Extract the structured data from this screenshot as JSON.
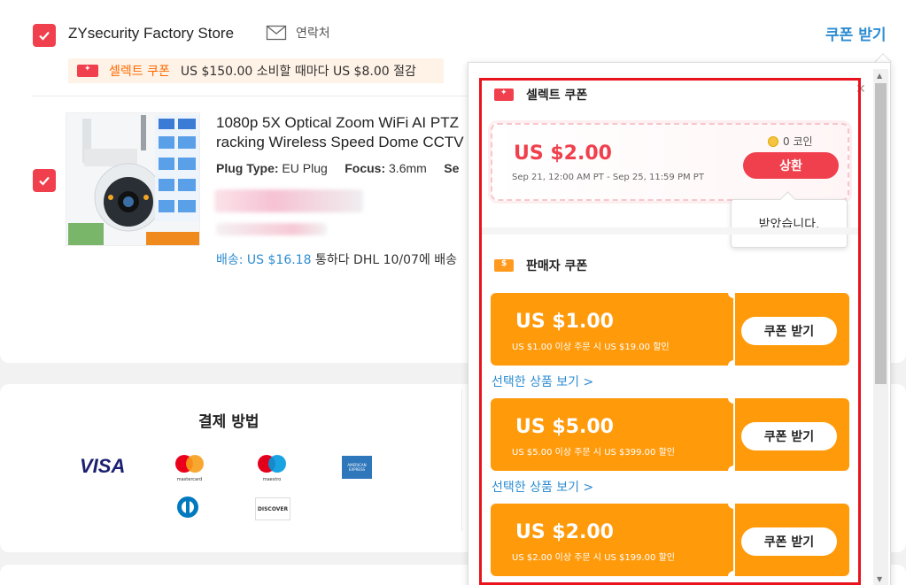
{
  "store": {
    "name": "ZYsecurity Factory Store",
    "contact_label": "연락처",
    "coupon_link": "쿠폰 받기"
  },
  "select_coupon_bar": {
    "label": "셀렉트 쿠폰",
    "description": "US $150.00 소비할 때마다 US $8.00 절감"
  },
  "product": {
    "title_line1": "1080p 5X Optical Zoom WiFi AI PTZ",
    "title_line2": "racking Wireless Speed Dome CCTV",
    "plug_label": "Plug Type:",
    "plug_value": "EU Plug",
    "focus_label": "Focus:",
    "focus_value": "3.6mm",
    "extra_label": "Se",
    "shipping_label": "배송: US $16.18",
    "shipping_rest": "통하다 DHL 10/07에 배송"
  },
  "payment": {
    "title": "결제 방법",
    "logos": [
      "VISA",
      "mastercard",
      "maestro",
      "AMERICAN EXPRESS",
      "Diners",
      "DISCOVER"
    ]
  },
  "popup": {
    "select_section_title": "셀렉트 쿠폰",
    "select_coupon": {
      "amount": "US $2.00",
      "period": "Sep 21, 12:00 AM PT - Sep 25, 11:59 PM PT",
      "coins": "0 코인",
      "redeem_label": "상환"
    },
    "tooltip": "받았습니다.",
    "seller_section_title": "판매자 쿠폰",
    "seller_coupons": [
      {
        "amount": "US $1.00",
        "desc": "US $1.00 이상 주문 시 US $19.00 할인",
        "button": "쿠폰 받기"
      },
      {
        "amount": "US $5.00",
        "desc": "US $5.00 이상 주문 시 US $399.00 할인",
        "button": "쿠폰 받기"
      },
      {
        "amount": "US $2.00",
        "desc": "US $2.00 이상 주문 시 US $199.00 할인",
        "button": "쿠폰 받기"
      }
    ],
    "view_products_link": "선택한 상품 보기 >",
    "close_icon": "close-icon"
  },
  "colors": {
    "accent_red": "#f0404d",
    "coupon_orange": "#ff9a0b",
    "link_blue": "#2d8cd2",
    "highlight_frame": "#e8131c"
  }
}
